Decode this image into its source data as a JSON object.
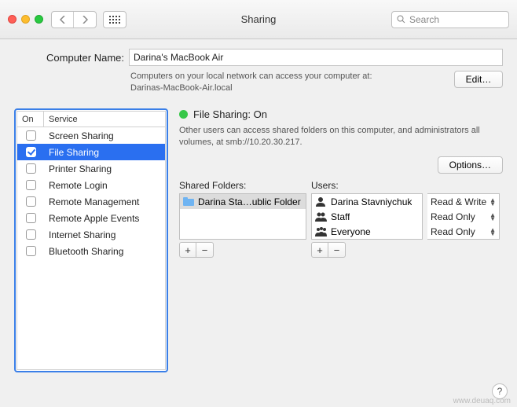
{
  "window": {
    "title": "Sharing"
  },
  "search": {
    "placeholder": "Search"
  },
  "computerName": {
    "label": "Computer Name:",
    "value": "Darina's MacBook Air",
    "subLine1": "Computers on your local network can access your computer at:",
    "subLine2": "Darinas-MacBook-Air.local",
    "editLabel": "Edit…"
  },
  "serviceTable": {
    "header": {
      "on": "On",
      "service": "Service"
    },
    "rows": [
      {
        "label": "Screen Sharing",
        "checked": false,
        "selected": false
      },
      {
        "label": "File Sharing",
        "checked": true,
        "selected": true
      },
      {
        "label": "Printer Sharing",
        "checked": false,
        "selected": false
      },
      {
        "label": "Remote Login",
        "checked": false,
        "selected": false
      },
      {
        "label": "Remote Management",
        "checked": false,
        "selected": false
      },
      {
        "label": "Remote Apple Events",
        "checked": false,
        "selected": false
      },
      {
        "label": "Internet Sharing",
        "checked": false,
        "selected": false
      },
      {
        "label": "Bluetooth Sharing",
        "checked": false,
        "selected": false
      }
    ]
  },
  "status": {
    "title": "File Sharing: On",
    "desc": "Other users can access shared folders on this computer, and administrators all volumes, at smb://10.20.30.217.",
    "optionsLabel": "Options…"
  },
  "sharedFolders": {
    "title": "Shared Folders:",
    "items": [
      {
        "label": "Darina Sta…ublic Folder",
        "selected": true
      }
    ]
  },
  "users": {
    "title": "Users:",
    "items": [
      {
        "label": "Darina Stavniychuk",
        "icon": "person"
      },
      {
        "label": "Staff",
        "icon": "group2"
      },
      {
        "label": "Everyone",
        "icon": "group3"
      }
    ]
  },
  "permissions": {
    "items": [
      {
        "label": "Read & Write"
      },
      {
        "label": "Read Only"
      },
      {
        "label": "Read Only"
      }
    ]
  },
  "buttons": {
    "plus": "+",
    "minus": "−",
    "help": "?"
  },
  "watermark": "www.deuaq.com"
}
